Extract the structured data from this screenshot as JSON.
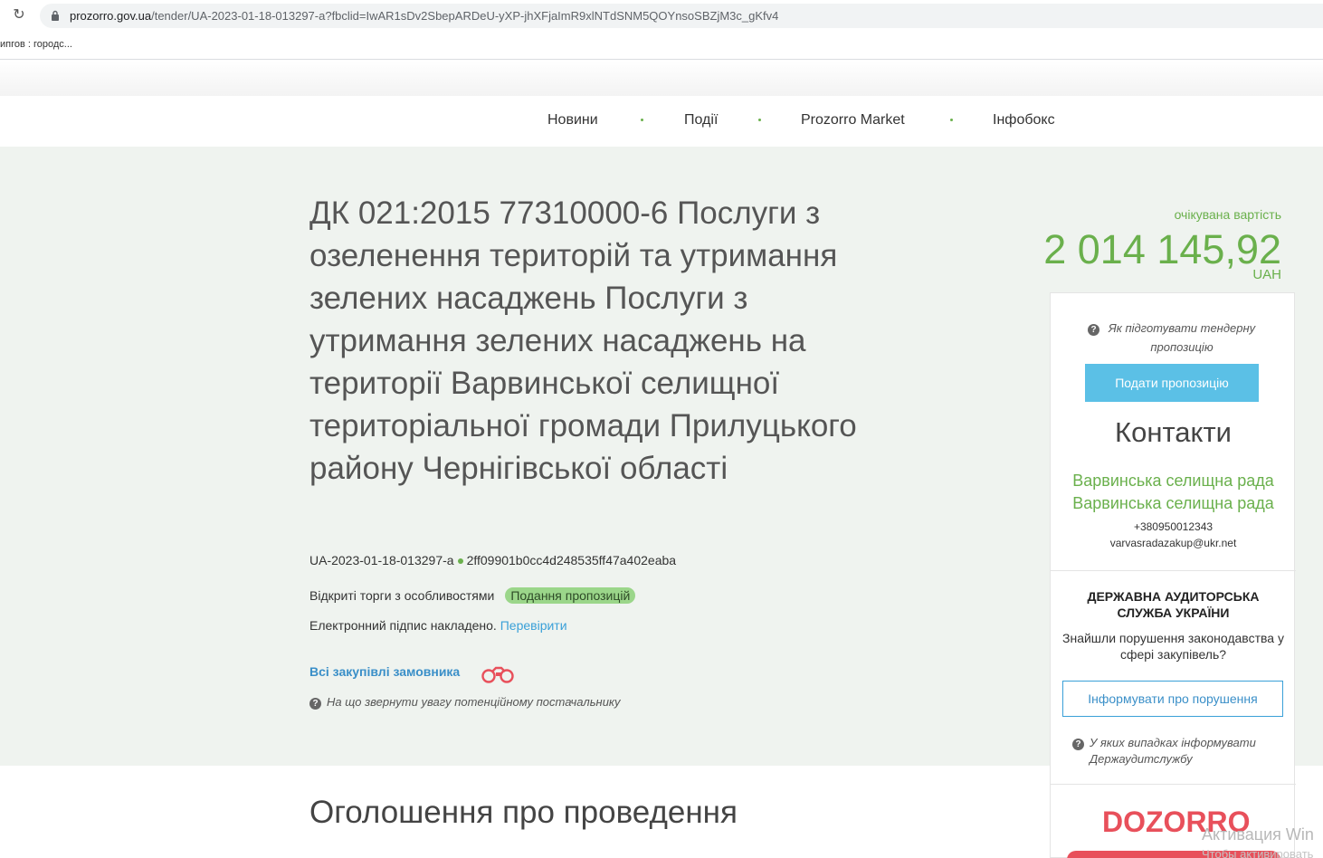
{
  "browser": {
    "url_host": "prozorro.gov.ua",
    "url_path": "/tender/UA-2023-01-18-013297-a?fbclid=IwAR1sDv2SbepARDeU-yXP-jhXFjaImR9xlNTdSNM5QOYnsoSBZjM3c_gKfv4",
    "bookmark": "ипгов : городс..."
  },
  "nav": {
    "items": [
      "Новини",
      "Події",
      "Prozorro Market",
      "Інфобокс"
    ]
  },
  "tender": {
    "title": "ДК 021:2015 77310000-6 Послуги з озеленення територій та утримання зелених насаджень Послуги з утримання зелених насаджень на території Варвинської селищної територіальної громади Прилуцького району Чернігівської області",
    "id": "UA-2023-01-18-013297-a",
    "hash": "2ff09901b0cc4d248535ff47a402eaba",
    "procedure": "Відкриті торги з особливостями",
    "status": "Подання пропозицій",
    "signature_text": "Електронний підпис накладено.",
    "signature_link": "Перевірити",
    "all_buyers_link": "Всі закупівлі замовника",
    "hint": "На що звернути увагу потенційному постачальнику"
  },
  "value": {
    "label": "очікувана вартість",
    "amount": "2 014 145,92",
    "currency": "UAH"
  },
  "panel": {
    "prepare_hint": "Як підготувати тендерну пропозицію",
    "submit_label": "Подати пропозицію",
    "contacts_title": "Контакти",
    "contact_name_1": "Варвинська селищна рада",
    "contact_name_2": "Варвинська селищна рада",
    "phone": "+380950012343",
    "email": "varvasradazakup@ukr.net",
    "audit_title": "ДЕРЖАВНА АУДИТОРСЬКА СЛУЖБА УКРАЇНИ",
    "audit_text": "Знайшли порушення законодавства у сфері закупівель?",
    "inform_label": "Інформувати про порушення",
    "audit_hint": "У яких випадках інформувати Держаудитслужбу",
    "dozorro": "DOZORRO"
  },
  "section": {
    "title": "Оголошення про проведення"
  },
  "os": {
    "watermark": "Активация Win",
    "watermark_sub": "Чтобы активировать"
  },
  "colors": {
    "accent_green": "#6ab04c",
    "link_blue": "#3aa0d8",
    "button_blue": "#5bc0e6",
    "dozorro_red": "#e8505b",
    "hero_bg": "#eff3ef"
  }
}
